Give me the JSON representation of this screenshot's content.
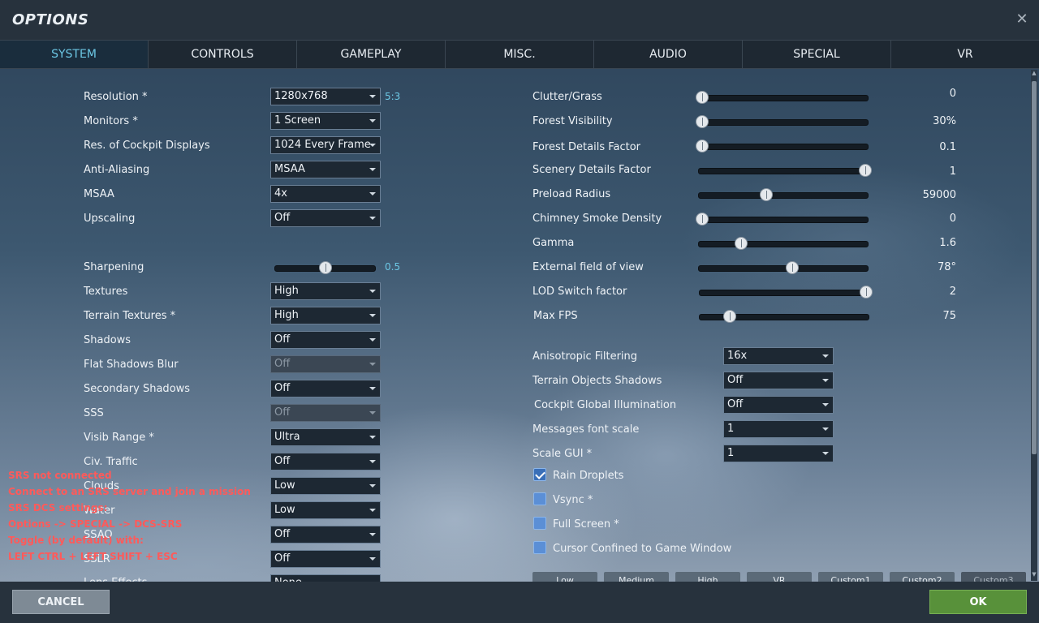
{
  "window": {
    "title": "OPTIONS",
    "close_symbol": "✕"
  },
  "tabs": [
    "SYSTEM",
    "CONTROLS",
    "GAMEPLAY",
    "MISC.",
    "AUDIO",
    "SPECIAL",
    "VR"
  ],
  "active_tab": "SYSTEM",
  "left": {
    "resolution": {
      "label": "Resolution *",
      "value": "1280x768",
      "aspect": "5:3"
    },
    "monitors": {
      "label": "Monitors *",
      "value": "1 Screen"
    },
    "cockpit_displays": {
      "label": "Res. of Cockpit Displays",
      "value": "1024 Every Frame"
    },
    "anti_aliasing": {
      "label": "Anti-Aliasing",
      "value": "MSAA"
    },
    "msaa": {
      "label": "MSAA",
      "value": "4x"
    },
    "upscaling": {
      "label": "Upscaling",
      "value": "Off"
    },
    "sharpening": {
      "label": "Sharpening",
      "value": "0.5",
      "level": 0.5
    },
    "textures": {
      "label": "Textures",
      "value": "High"
    },
    "terrain_textures": {
      "label": "Terrain Textures *",
      "value": "High"
    },
    "shadows": {
      "label": "Shadows",
      "value": "Off"
    },
    "flat_shadows_blur": {
      "label": "Flat Shadows Blur",
      "value": "Off",
      "disabled": true
    },
    "secondary_shadows": {
      "label": "Secondary Shadows",
      "value": "Off"
    },
    "sss": {
      "label": "SSS",
      "value": "Off",
      "disabled": true
    },
    "visib_range": {
      "label": "Visib Range *",
      "value": "Ultra"
    },
    "civ_traffic": {
      "label": "Civ. Traffic",
      "value": "Off"
    },
    "clouds": {
      "label": "Clouds",
      "value": "Low"
    },
    "water": {
      "label": "Water",
      "value": "Low"
    },
    "ssao": {
      "label": "SSAO",
      "value": "Off"
    },
    "sslr": {
      "label": "SSLR",
      "value": "Off"
    },
    "lens_effects": {
      "label": "Lens Effects",
      "value": "None"
    }
  },
  "right_sliders": [
    {
      "label": "Clutter/Grass",
      "value": "0",
      "level": 0.0
    },
    {
      "label": "Forest Visibility",
      "value": "30%",
      "level": 0.0
    },
    {
      "label": "Forest Details Factor",
      "value": "0.1",
      "level": 0.0
    },
    {
      "label": "Scenery Details Factor",
      "value": "1",
      "level": 1.0
    },
    {
      "label": "Preload Radius",
      "value": "59000",
      "level": 0.4
    },
    {
      "label": "Chimney Smoke Density",
      "value": "0",
      "level": 0.0
    },
    {
      "label": "Gamma",
      "value": "1.6",
      "level": 0.25
    },
    {
      "label": "External field of view",
      "value": "78°",
      "level": 0.55
    },
    {
      "label": "LOD Switch factor",
      "value": "2",
      "level": 1.0
    },
    {
      "label": "Max FPS",
      "value": "75",
      "level": 0.18
    }
  ],
  "right_dropdowns": [
    {
      "label": "Anisotropic Filtering",
      "value": "16x"
    },
    {
      "label": "Terrain Objects Shadows",
      "value": "Off"
    },
    {
      "label": "Cockpit Global Illumination",
      "value": "Off"
    },
    {
      "label": "Messages font scale",
      "value": "1"
    },
    {
      "label": "Scale GUI *",
      "value": "1"
    }
  ],
  "checkboxes": [
    {
      "label": "Rain Droplets",
      "checked": true
    },
    {
      "label": "Vsync *",
      "checked": false
    },
    {
      "label": "Full Screen *",
      "checked": false
    },
    {
      "label": "Cursor Confined to Game Window",
      "checked": false
    }
  ],
  "presets": [
    "Low",
    "Medium",
    "High",
    "VR",
    "Custom1",
    "Custom2",
    "Custom3"
  ],
  "srs_overlay": [
    "SRS not connected",
    "Connect to an SRS server and join a mission",
    "SRS DCS settings:",
    "Options -> SPECIAL -> DCS-SRS",
    "Toggle (by default) with:",
    "LEFT CTRL + LEFT SHIFT + ESC"
  ],
  "footer": {
    "cancel": "CANCEL",
    "ok": "OK"
  },
  "colors": {
    "accent": "#6cc7e4",
    "ok": "#58913a",
    "warning": "#ff5a5a"
  }
}
